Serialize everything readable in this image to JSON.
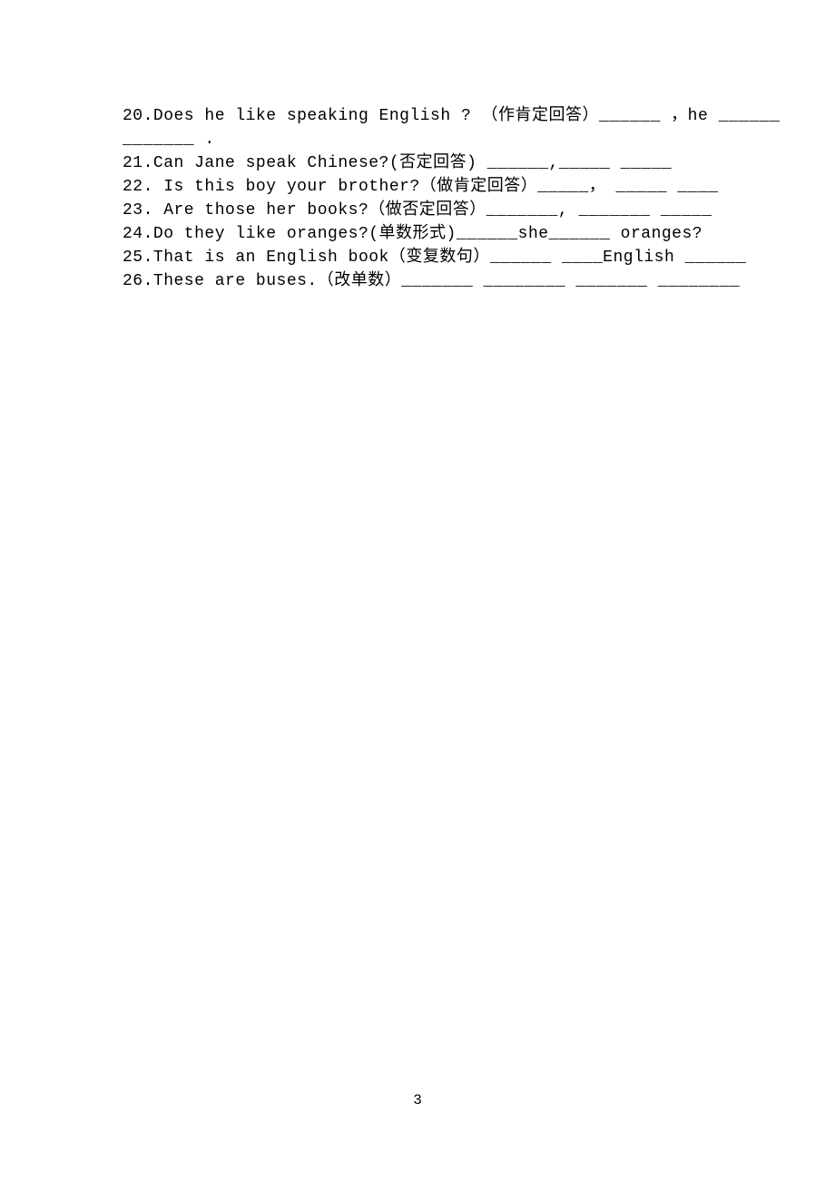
{
  "lines": {
    "l20a": "20.Does he like speaking English ? （作肯定回答）______   ，he ______",
    "l20b": "_______              .",
    "l21": "21.Can Jane speak Chinese?(否定回答) ______,_____ _____",
    "l22": "22. Is this boy your brother?（做肯定回答）_____， _____ ____",
    "l23": "23. Are those her books?（做否定回答）_______, _______ _____",
    "l24": "24.Do they like oranges?(单数形式)______she______ oranges?",
    "l25": "25.That is an English book（变复数句）______ ____English ______",
    "l26": "26.These are buses.（改单数）_______ ________ _______ ________"
  },
  "page_number": "3"
}
